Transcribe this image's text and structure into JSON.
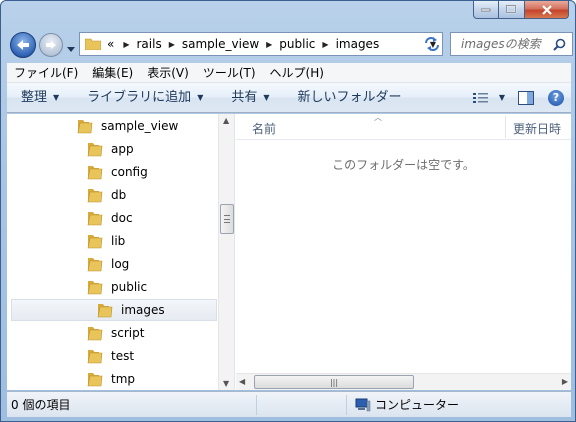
{
  "window": {
    "minimize_label": "–",
    "maximize_label": "□",
    "close_label": "✕"
  },
  "address": {
    "overflow": "«",
    "crumbs": [
      "rails",
      "sample_view",
      "public",
      "images"
    ]
  },
  "search": {
    "placeholder": "imagesの検索"
  },
  "menubar": [
    "ファイル(F)",
    "編集(E)",
    "表示(V)",
    "ツール(T)",
    "ヘルプ(H)"
  ],
  "toolbar": {
    "organize": "整理",
    "library": "ライブラリに追加",
    "share": "共有",
    "new_folder": "新しいフォルダー"
  },
  "tree": [
    {
      "label": "sample_view",
      "indent": 0
    },
    {
      "label": "app",
      "indent": 1
    },
    {
      "label": "config",
      "indent": 1
    },
    {
      "label": "db",
      "indent": 1
    },
    {
      "label": "doc",
      "indent": 1
    },
    {
      "label": "lib",
      "indent": 1
    },
    {
      "label": "log",
      "indent": 1
    },
    {
      "label": "public",
      "indent": 1
    },
    {
      "label": "images",
      "indent": 2,
      "selected": true
    },
    {
      "label": "script",
      "indent": 1
    },
    {
      "label": "test",
      "indent": 1
    },
    {
      "label": "tmp",
      "indent": 1
    }
  ],
  "filepane": {
    "col_name": "名前",
    "col_date": "更新日時",
    "empty_message": "このフォルダーは空です。"
  },
  "status": {
    "item_count": "0 個の項目",
    "location": "コンピューター"
  },
  "colors": {
    "folder": "#e8c45a",
    "accent": "#1e395b"
  }
}
